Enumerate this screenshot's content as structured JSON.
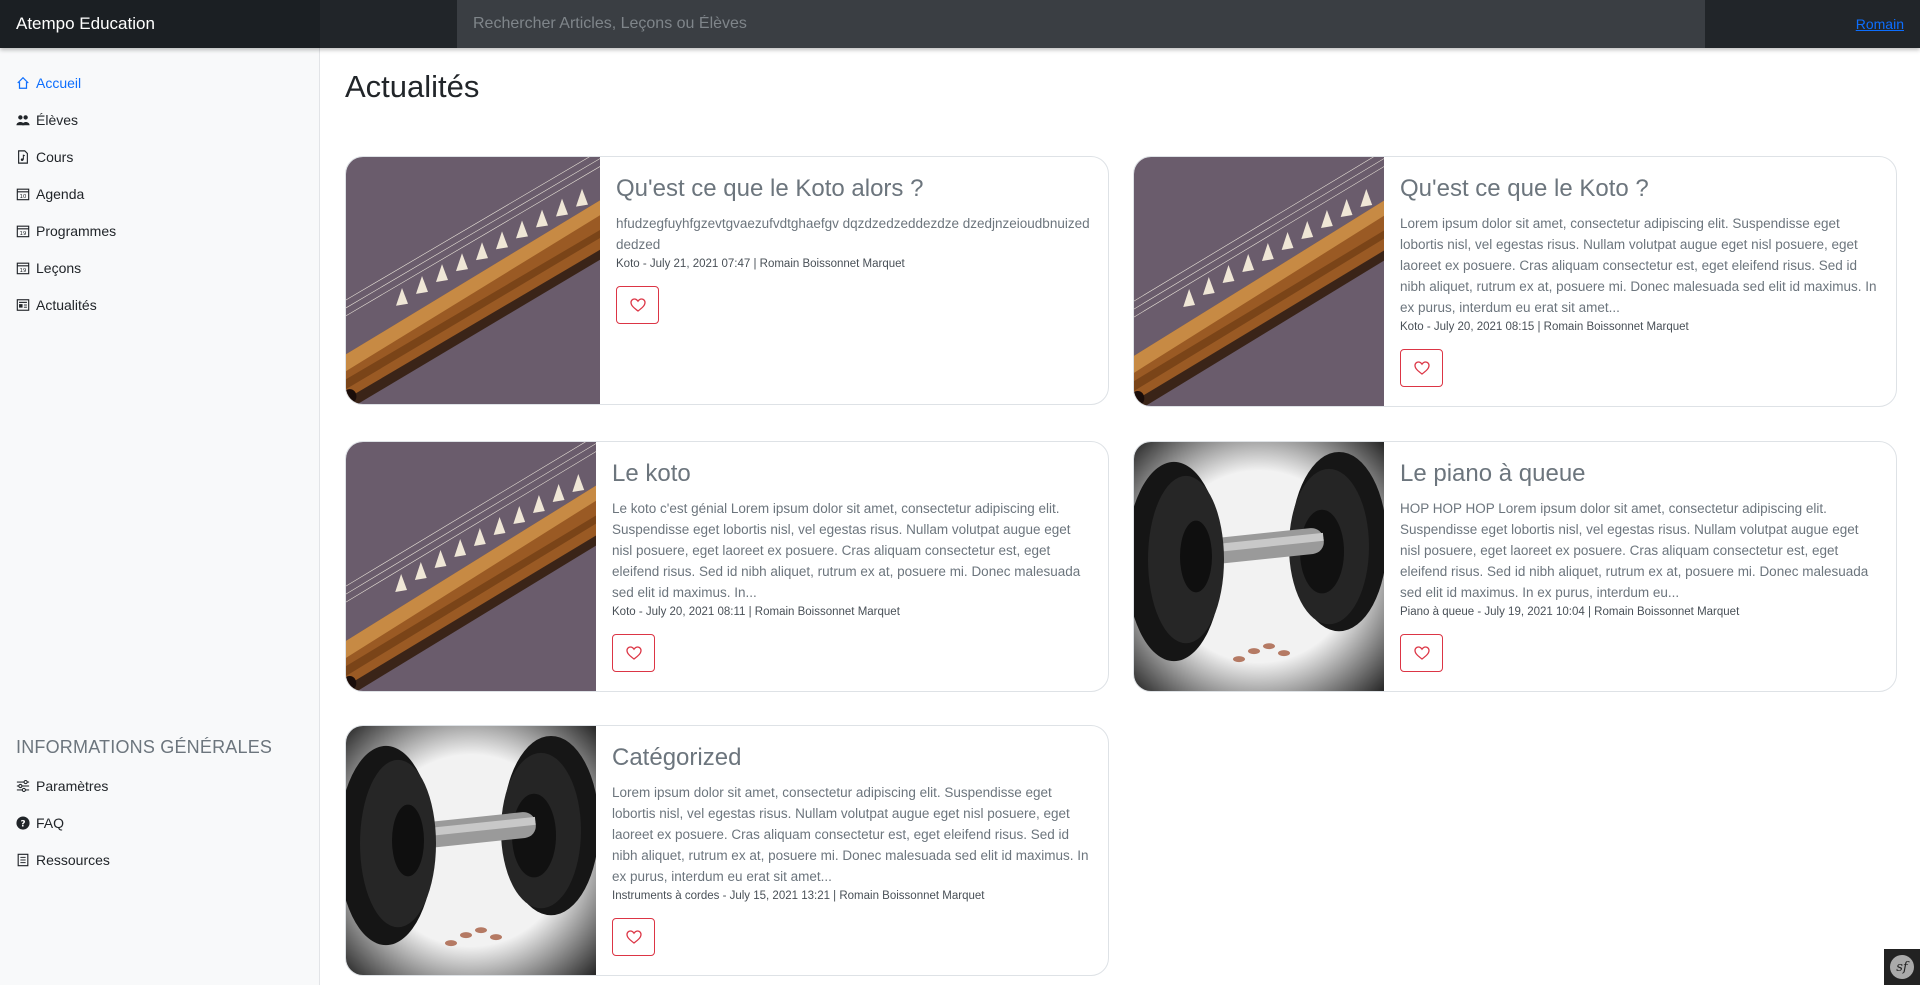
{
  "app": {
    "brand": "Atempo Education",
    "user": "Romain"
  },
  "search": {
    "placeholder": "Rechercher Articles, Leçons ou Élèves"
  },
  "sidebar": {
    "items": [
      {
        "label": "Accueil",
        "icon": "home-icon",
        "active": true
      },
      {
        "label": "Élèves",
        "icon": "people-icon"
      },
      {
        "label": "Cours",
        "icon": "music-file-icon"
      },
      {
        "label": "Agenda",
        "icon": "calendar-icon"
      },
      {
        "label": "Programmes",
        "icon": "calendar-icon"
      },
      {
        "label": "Leçons",
        "icon": "calendar-icon"
      },
      {
        "label": "Actualités",
        "icon": "newspaper-icon"
      }
    ],
    "section_heading": "INFORMATIONS GÉNÉRALES",
    "info_items": [
      {
        "label": "Paramètres",
        "icon": "sliders-icon"
      },
      {
        "label": "FAQ",
        "icon": "question-circle-icon"
      },
      {
        "label": "Ressources",
        "icon": "document-list-icon"
      }
    ]
  },
  "page": {
    "title": "Actualités"
  },
  "articles": [
    {
      "title": "Qu'est ce que le Koto alors ?",
      "excerpt": "hfudzegfuyhfgzevtgvaezufvdtghaefgv dqzdzedzeddezdze dzedjnzeioudbnuized dedzed",
      "meta": "Koto - July 21, 2021 07:47 | Romain Boissonnet Marquet",
      "image": "koto"
    },
    {
      "title": "Qu'est ce que le Koto ?",
      "excerpt": "Lorem ipsum dolor sit amet, consectetur adipiscing elit. Suspendisse eget lobortis nisl, vel egestas risus. Nullam volutpat augue eget nisl posuere, eget laoreet ex posuere. Cras aliquam consectetur est, eget eleifend risus. Sed id nibh aliquet, rutrum ex at, posuere mi. Donec malesuada sed elit id maximus. In ex purus, interdum eu erat sit amet...",
      "meta": "Koto - July 20, 2021 08:15 | Romain Boissonnet Marquet",
      "image": "koto"
    },
    {
      "title": "Le koto",
      "excerpt": "Le koto c'est génial Lorem ipsum dolor sit amet, consectetur adipiscing elit. Suspendisse eget lobortis nisl, vel egestas risus. Nullam volutpat augue eget nisl posuere, eget laoreet ex posuere. Cras aliquam consectetur est, eget eleifend risus. Sed id nibh aliquet, rutrum ex at, posuere mi. Donec malesuada sed elit id maximus. In...",
      "meta": "Koto - July 20, 2021 08:11 | Romain Boissonnet Marquet",
      "image": "koto"
    },
    {
      "title": "Le piano à queue",
      "excerpt": "HOP HOP HOP Lorem ipsum dolor sit amet, consectetur adipiscing elit. Suspendisse eget lobortis nisl, vel egestas risus. Nullam volutpat augue eget nisl posuere, eget laoreet ex posuere. Cras aliquam consectetur est, eget eleifend risus. Sed id nibh aliquet, rutrum ex at, posuere mi. Donec malesuada sed elit id maximus. In ex purus, interdum eu...",
      "meta": "Piano à queue - July 19, 2021 10:04 | Romain Boissonnet Marquet",
      "image": "dumbbell"
    },
    {
      "title": "Catégorized",
      "excerpt": "Lorem ipsum dolor sit amet, consectetur adipiscing elit. Suspendisse eget lobortis nisl, vel egestas risus. Nullam volutpat augue eget nisl posuere, eget laoreet ex posuere. Cras aliquam consectetur est, eget eleifend risus. Sed id nibh aliquet, rutrum ex at, posuere mi. Donec malesuada sed elit id maximus. In ex purus, interdum eu erat sit amet...",
      "meta": "Instruments à cordes - July 15, 2021 13:21 | Romain Boissonnet Marquet",
      "image": "dumbbell"
    }
  ],
  "colors": {
    "accent": "#0d6efd",
    "topbar": "#212529",
    "like": "#dc3545"
  }
}
